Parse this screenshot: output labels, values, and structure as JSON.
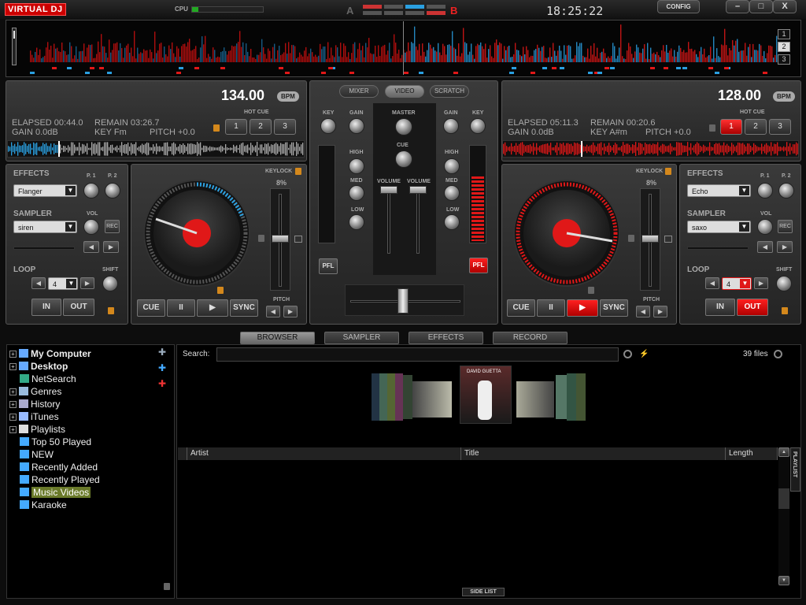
{
  "app": {
    "logo": "VIRTUAL DJ",
    "cpu_label": "CPU",
    "deck_a_letter": "A",
    "deck_b_letter": "B",
    "clock": "18:25:22",
    "config_label": "CONFIG",
    "minimize": "–",
    "maximize": "□",
    "close": "X"
  },
  "overview": {
    "decks": [
      "1",
      "2",
      "3"
    ]
  },
  "deck_left": {
    "bpm": "134.00",
    "bpm_tag": "BPM",
    "elapsed": "ELAPSED 00:44.0",
    "remain": "REMAIN 03:26.7",
    "gain": "GAIN 0.0dB",
    "key": "KEY Fm",
    "pitch": "PITCH +0.0",
    "hot_cue_label": "HOT CUE",
    "hot_cues": [
      "1",
      "2",
      "3"
    ],
    "effects_label": "EFFECTS",
    "effect": "Flanger",
    "p1": "P. 1",
    "p2": "P. 2",
    "sampler_label": "SAMPLER",
    "sample": "siren",
    "vol": "VOL",
    "rec": "REC",
    "loop_label": "LOOP",
    "loop_value": "4",
    "shift": "SHIFT",
    "in": "IN",
    "out": "OUT",
    "keylock": "KEYLOCK",
    "keylock_pct": "8%",
    "pitch_label": "PITCH",
    "transport": [
      "CUE",
      "II",
      "▶",
      "SYNC"
    ]
  },
  "deck_right": {
    "bpm": "128.00",
    "bpm_tag": "BPM",
    "elapsed": "ELAPSED 05:11.3",
    "remain": "REMAIN 00:20.6",
    "gain": "GAIN 0.0dB",
    "key": "KEY A#m",
    "pitch": "PITCH +0.0",
    "hot_cue_label": "HOT CUE",
    "hot_cues": [
      "1",
      "2",
      "3"
    ],
    "effects_label": "EFFECTS",
    "effect": "Echo",
    "p1": "P. 1",
    "p2": "P. 2",
    "sampler_label": "SAMPLER",
    "sample": "saxo",
    "vol": "VOL",
    "rec": "REC",
    "loop_label": "LOOP",
    "loop_value": "4",
    "shift": "SHIFT",
    "in": "IN",
    "out": "OUT",
    "keylock": "KEYLOCK",
    "keylock_pct": "8%",
    "pitch_label": "PITCH",
    "transport": [
      "CUE",
      "II",
      "▶",
      "SYNC"
    ]
  },
  "mixer": {
    "tabs": [
      "MIXER",
      "VIDEO",
      "SCRATCH"
    ],
    "key": "KEY",
    "gain": "GAIN",
    "master": "MASTER",
    "cue": "CUE",
    "high": "HIGH",
    "med": "MED",
    "low": "LOW",
    "volume": "VOLUME",
    "pfl": "PFL"
  },
  "bottom_tabs": [
    "BROWSER",
    "SAMPLER",
    "EFFECTS",
    "RECORD"
  ],
  "browser": {
    "search_label": "Search:",
    "search_value": "",
    "file_count": "39 files",
    "columns": [
      "Artist",
      "Title",
      "Length"
    ],
    "playlist_tab": "PLAYLIST",
    "side_list": "SIDE LIST",
    "cover_text": "DAVID GUETTA"
  },
  "tree": [
    {
      "label": "My Computer",
      "expand": "+",
      "icon": "computer-icon"
    },
    {
      "label": "Desktop",
      "expand": "+",
      "icon": "desktop-icon"
    },
    {
      "label": "NetSearch",
      "expand": "",
      "icon": "globe-icon"
    },
    {
      "label": "Genres",
      "expand": "+",
      "icon": "genres-icon"
    },
    {
      "label": "History",
      "expand": "+",
      "icon": "history-icon"
    },
    {
      "label": "iTunes",
      "expand": "+",
      "icon": "itunes-icon"
    },
    {
      "label": "Playlists",
      "expand": "+",
      "icon": "playlist-icon"
    },
    {
      "label": "Top 50 Played",
      "expand": "",
      "icon": "folder-icon"
    },
    {
      "label": "NEW",
      "expand": "",
      "icon": "folder-icon"
    },
    {
      "label": "Recently Added",
      "expand": "",
      "icon": "folder-icon"
    },
    {
      "label": "Recently Played",
      "expand": "",
      "icon": "folder-icon"
    },
    {
      "label": "Music Videos",
      "expand": "",
      "icon": "folder-icon",
      "selected": true
    },
    {
      "label": "Karaoke",
      "expand": "",
      "icon": "folder-icon"
    }
  ],
  "colors": {
    "accent_red": "#e01818",
    "accent_blue": "#2a9fe0",
    "selected_folder": "#6a7a2a"
  }
}
